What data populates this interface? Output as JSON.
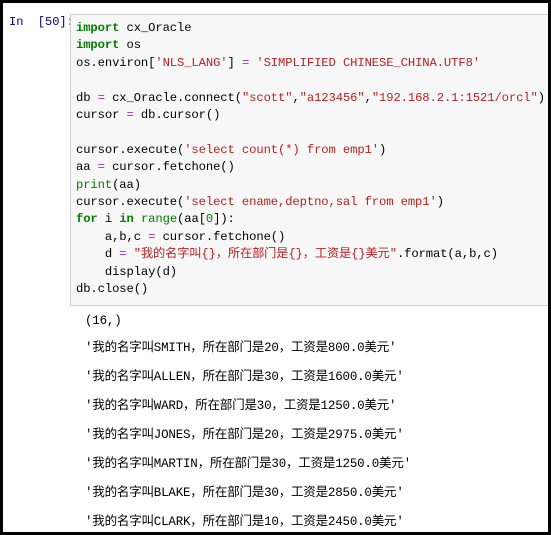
{
  "notebook": {
    "cell": {
      "prompt_label": "In  [50]:",
      "execution_count": "50",
      "code_lines": [
        [
          {
            "t": "import",
            "c": "k"
          },
          {
            "t": " cx_Oracle",
            "c": "n"
          }
        ],
        [
          {
            "t": "import",
            "c": "k"
          },
          {
            "t": " os",
            "c": "n"
          }
        ],
        [
          {
            "t": "os.environ[",
            "c": "n"
          },
          {
            "t": "'NLS_LANG'",
            "c": "s"
          },
          {
            "t": "] ",
            "c": "n"
          },
          {
            "t": "=",
            "c": "o"
          },
          {
            "t": " ",
            "c": "n"
          },
          {
            "t": "'SIMPLIFIED CHINESE_CHINA.UTF8'",
            "c": "s"
          }
        ],
        [
          {
            "t": "",
            "c": "n"
          }
        ],
        [
          {
            "t": "db ",
            "c": "n"
          },
          {
            "t": "=",
            "c": "o"
          },
          {
            "t": " cx_Oracle.connect(",
            "c": "n"
          },
          {
            "t": "\"scott\"",
            "c": "s"
          },
          {
            "t": ",",
            "c": "n"
          },
          {
            "t": "\"a123456\"",
            "c": "s"
          },
          {
            "t": ",",
            "c": "n"
          },
          {
            "t": "\"192.168.2.1:1521/orcl\"",
            "c": "s"
          },
          {
            "t": ")",
            "c": "n"
          }
        ],
        [
          {
            "t": "cursor ",
            "c": "n"
          },
          {
            "t": "=",
            "c": "o"
          },
          {
            "t": " db.cursor()",
            "c": "n"
          }
        ],
        [
          {
            "t": "",
            "c": "n"
          }
        ],
        [
          {
            "t": "cursor.execute(",
            "c": "n"
          },
          {
            "t": "'select count(*) from emp1'",
            "c": "s"
          },
          {
            "t": ")",
            "c": "n"
          }
        ],
        [
          {
            "t": "aa ",
            "c": "n"
          },
          {
            "t": "=",
            "c": "o"
          },
          {
            "t": " cursor.fetchone()",
            "c": "n"
          }
        ],
        [
          {
            "t": "print",
            "c": "nb"
          },
          {
            "t": "(aa)",
            "c": "n"
          }
        ],
        [
          {
            "t": "cursor.execute(",
            "c": "n"
          },
          {
            "t": "'select ename,deptno,sal from emp1'",
            "c": "s"
          },
          {
            "t": ")",
            "c": "n"
          }
        ],
        [
          {
            "t": "for",
            "c": "k"
          },
          {
            "t": " i ",
            "c": "n"
          },
          {
            "t": "in",
            "c": "k"
          },
          {
            "t": " ",
            "c": "n"
          },
          {
            "t": "range",
            "c": "nb"
          },
          {
            "t": "(aa[",
            "c": "n"
          },
          {
            "t": "0",
            "c": "mi"
          },
          {
            "t": "]):",
            "c": "n"
          }
        ],
        [
          {
            "t": "    a,b,c ",
            "c": "n"
          },
          {
            "t": "=",
            "c": "o"
          },
          {
            "t": " cursor.fetchone()",
            "c": "n"
          }
        ],
        [
          {
            "t": "    d ",
            "c": "n"
          },
          {
            "t": "=",
            "c": "o"
          },
          {
            "t": " ",
            "c": "n"
          },
          {
            "t": "\"我的名字叫{}，所在部门是{}，工资是{}美元\"",
            "c": "s"
          },
          {
            "t": ".format(a,b,c)",
            "c": "n"
          }
        ],
        [
          {
            "t": "    display(d)",
            "c": "n"
          }
        ],
        [
          {
            "t": "db.close()",
            "c": "n"
          }
        ]
      ],
      "output_lines": [
        "(16,)",
        "'我的名字叫SMITH，所在部门是20，工资是800.0美元'",
        "'我的名字叫ALLEN，所在部门是30，工资是1600.0美元'",
        "'我的名字叫WARD，所在部门是30，工资是1250.0美元'",
        "'我的名字叫JONES，所在部门是20，工资是2975.0美元'",
        "'我的名字叫MARTIN，所在部门是30，工资是1250.0美元'",
        "'我的名字叫BLAKE，所在部门是30，工资是2850.0美元'",
        "'我的名字叫CLARK，所在部门是10，工资是2450.0美元'"
      ]
    }
  },
  "colors": {
    "prompt": "#000080",
    "keyword": "#008000",
    "builtin": "#008000",
    "string": "#ba2121",
    "operator": "#aa22ff",
    "number": "#008000",
    "cell_background": "#f7f7f7",
    "cell_border": "#cfcfcf",
    "page_background": "#ffffff",
    "frame": "#000000"
  }
}
